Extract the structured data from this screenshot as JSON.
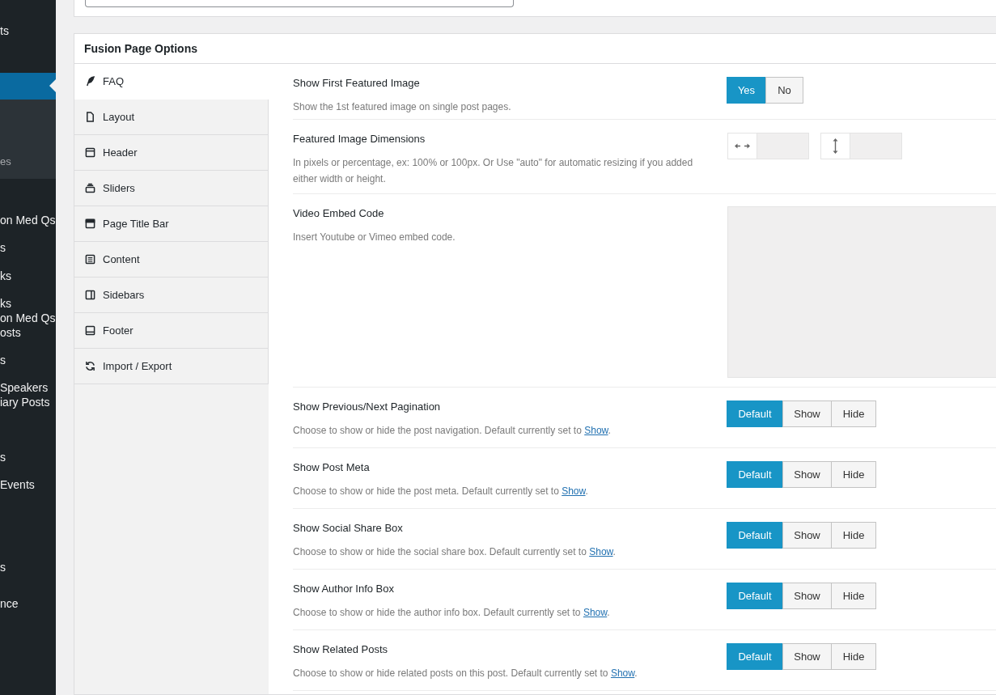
{
  "sidebar": {
    "items": [
      {
        "label": "ts",
        "selected": false
      },
      {
        "selected": true,
        "submenu": [
          {
            "label": "es"
          }
        ]
      },
      {
        "label": "on Med Qs",
        "selected": false
      },
      {
        "label": "s",
        "selected": false
      },
      {
        "label": "ks",
        "selected": false
      },
      {
        "label": "ks",
        "selected": false
      },
      {
        "label": "on Med Qs",
        "selected": false
      },
      {
        "label": "osts",
        "selected": false
      },
      {
        "label": "s",
        "selected": false
      },
      {
        "label": "Speakers",
        "selected": false
      },
      {
        "label": "iary Posts",
        "selected": false
      },
      {
        "label": "s",
        "selected": false
      },
      {
        "label": "Events",
        "selected": false
      },
      {
        "label": "s",
        "selected": false
      },
      {
        "label": "nce",
        "selected": false
      }
    ]
  },
  "panel": {
    "title": "Fusion Page Options",
    "tabs": [
      {
        "label": "FAQ",
        "kind": "feather",
        "selected": true
      },
      {
        "label": "Layout",
        "kind": "file",
        "selected": false
      },
      {
        "label": "Header",
        "kind": "header",
        "selected": false
      },
      {
        "label": "Sliders",
        "kind": "sliders",
        "selected": false
      },
      {
        "label": "Page Title Bar",
        "kind": "titlebar",
        "selected": false
      },
      {
        "label": "Content",
        "kind": "content",
        "selected": false
      },
      {
        "label": "Sidebars",
        "kind": "sidebar",
        "selected": false
      },
      {
        "label": "Footer",
        "kind": "footer",
        "selected": false
      },
      {
        "label": "Import / Export",
        "kind": "refresh",
        "selected": false
      }
    ],
    "options": [
      {
        "kind": "toggle",
        "title": "Show First Featured Image",
        "description": "Show the 1st featured image on single post pages.",
        "choices": [
          {
            "label": "Yes",
            "selected": true
          },
          {
            "label": "No",
            "selected": false
          }
        ]
      },
      {
        "kind": "dimensions",
        "title": "Featured Image Dimensions",
        "description": "In pixels or percentage, ex: 100% or 100px. Or Use \"auto\" for automatic resizing if you added either width or height."
      },
      {
        "kind": "textarea",
        "title": "Video Embed Code",
        "description": "Insert Youtube or Vimeo embed code."
      },
      {
        "kind": "toggle",
        "title": "Show Previous/Next Pagination",
        "description": "Choose to show or hide the post navigation. Default currently set to ",
        "link": "Show",
        "after": ".",
        "choices": [
          {
            "label": "Default",
            "selected": true
          },
          {
            "label": "Show",
            "selected": false
          },
          {
            "label": "Hide",
            "selected": false
          }
        ]
      },
      {
        "kind": "toggle",
        "title": "Show Post Meta",
        "description": "Choose to show or hide the post meta. Default currently set to ",
        "link": "Show",
        "after": ".",
        "choices": [
          {
            "label": "Default",
            "selected": true
          },
          {
            "label": "Show",
            "selected": false
          },
          {
            "label": "Hide",
            "selected": false
          }
        ]
      },
      {
        "kind": "toggle",
        "title": "Show Social Share Box",
        "description": "Choose to show or hide the social share box. Default currently set to ",
        "link": "Show",
        "after": ".",
        "choices": [
          {
            "label": "Default",
            "selected": true
          },
          {
            "label": "Show",
            "selected": false
          },
          {
            "label": "Hide",
            "selected": false
          }
        ]
      },
      {
        "kind": "toggle",
        "title": "Show Author Info Box",
        "description": "Choose to show or hide the author info box. Default currently set to ",
        "link": "Show",
        "after": ".",
        "choices": [
          {
            "label": "Default",
            "selected": true
          },
          {
            "label": "Show",
            "selected": false
          },
          {
            "label": "Hide",
            "selected": false
          }
        ]
      },
      {
        "kind": "toggle",
        "title": "Show Related Posts",
        "description": "Choose to show or hide related posts on this post. Default currently set to ",
        "link": "Show",
        "after": ".",
        "choices": [
          {
            "label": "Default",
            "selected": true
          },
          {
            "label": "Show",
            "selected": false
          },
          {
            "label": "Hide",
            "selected": false
          }
        ]
      }
    ]
  }
}
